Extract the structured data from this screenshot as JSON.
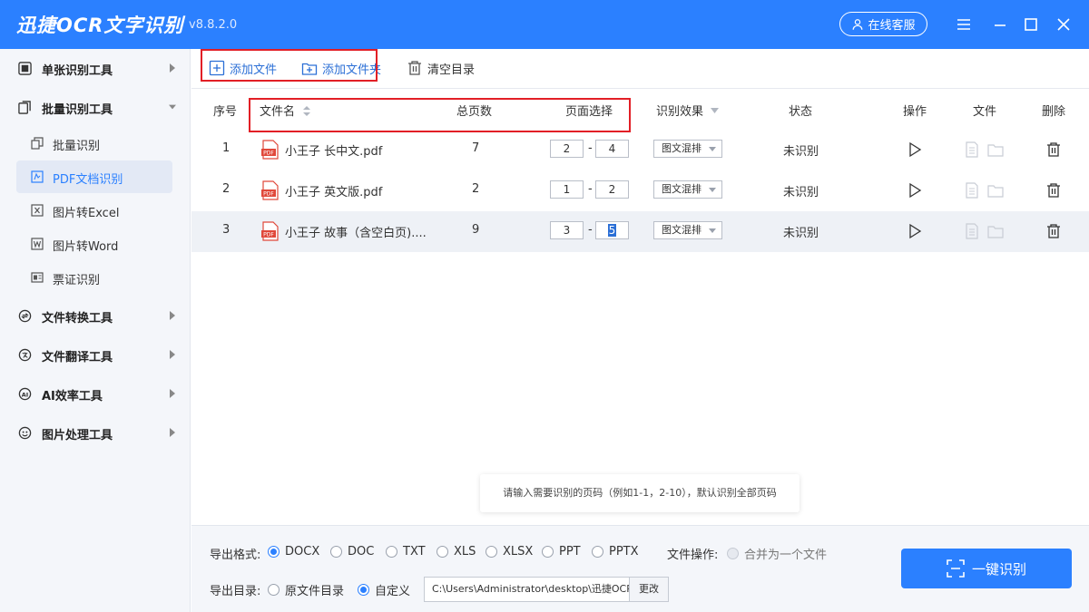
{
  "app": {
    "title": "迅捷OCR文字识别",
    "version": "v8.8.2.0",
    "service_label": "在线客服"
  },
  "sidebar": {
    "groups": [
      {
        "label": "单张识别工具",
        "icon": "scan-icon"
      },
      {
        "label": "批量识别工具",
        "icon": "batch-icon"
      },
      {
        "label": "文件转换工具",
        "icon": "convert-icon"
      },
      {
        "label": "文件翻译工具",
        "icon": "translate-icon"
      },
      {
        "label": "AI效率工具",
        "icon": "ai-icon"
      },
      {
        "label": "图片处理工具",
        "icon": "image-icon"
      }
    ],
    "batch_items": [
      {
        "label": "批量识别",
        "icon": "copy-icon"
      },
      {
        "label": "PDF文档识别",
        "icon": "pdf-doc-icon"
      },
      {
        "label": "图片转Excel",
        "icon": "excel-icon"
      },
      {
        "label": "图片转Word",
        "icon": "word-icon"
      },
      {
        "label": "票证识别",
        "icon": "ticket-icon"
      }
    ]
  },
  "toolbar": {
    "add_file": "添加文件",
    "add_folder": "添加文件夹",
    "clear": "清空目录"
  },
  "table": {
    "headers": {
      "index": "序号",
      "filename": "文件名",
      "pages": "总页数",
      "page_select": "页面选择",
      "effect": "识别效果",
      "status": "状态",
      "action": "操作",
      "file": "文件",
      "delete": "删除"
    },
    "rows": [
      {
        "index": "1",
        "filename": "小王子 长中文.pdf",
        "pages": "7",
        "from": "2",
        "to": "4",
        "effect": "图文混排",
        "status": "未识别"
      },
      {
        "index": "2",
        "filename": "小王子 英文版.pdf",
        "pages": "2",
        "from": "1",
        "to": "2",
        "effect": "图文混排",
        "status": "未识别"
      },
      {
        "index": "3",
        "filename": "小王子 故事（含空白页)....",
        "pages": "9",
        "from": "3",
        "to": "5",
        "effect": "图文混排",
        "status": "未识别"
      }
    ]
  },
  "hint": "请输入需要识别的页码（例如1-1，2-10），默认识别全部页码",
  "bottom": {
    "format_label": "导出格式:",
    "formats": [
      "DOCX",
      "DOC",
      "TXT",
      "XLS",
      "XLSX",
      "PPT",
      "PPTX"
    ],
    "selected_format": "DOCX",
    "file_op_label": "文件操作:",
    "merge_label": "合并为一个文件",
    "dir_label": "导出目录:",
    "dir_original": "原文件目录",
    "dir_custom": "自定义",
    "path": "C:\\Users\\Administrator\\desktop\\迅捷OCR文",
    "change_label": "更改",
    "ocr_button": "一键识别"
  },
  "colors": {
    "brand": "#2b80ff",
    "highlight_box": "#e21f26"
  }
}
